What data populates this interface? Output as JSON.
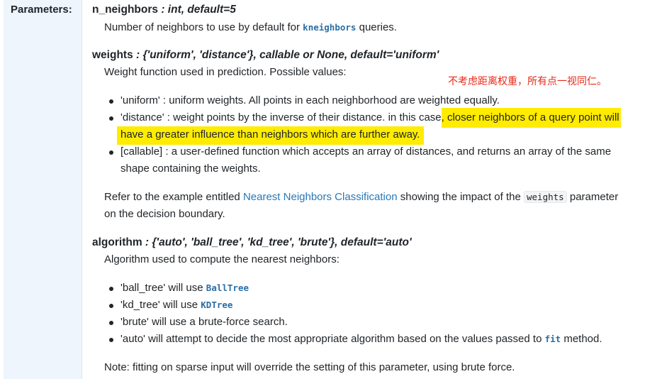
{
  "section_label": "Parameters:",
  "params": {
    "n_neighbors": {
      "name": "n_neighbors",
      "type_text": " : int, default=5",
      "desc_prefix": "Number of neighbors to use by default for ",
      "desc_code": "kneighbors",
      "desc_suffix": " queries."
    },
    "weights": {
      "name": "weights",
      "type_text": " : {'uniform', 'distance'}, callable or None, default='uniform'",
      "desc": "Weight function used in prediction. Possible values:",
      "annotation": "不考虑距离权重，所有点一视同仁。",
      "items": {
        "uniform": "'uniform' : uniform weights. All points in each neighborhood are weighted equally.",
        "distance_a": "'distance' : weight points by the inverse of their distance. in this case",
        "distance_b": ", closer neighbors of a query point will",
        "distance_c": "have a greater influence than neighbors which are further away.",
        "callable_a": "[callable] : a user-defined function which accepts an array of distances, and returns an array of the same",
        "callable_b": "shape containing the weights."
      },
      "refer_prefix": "Refer to the example entitled ",
      "refer_link": "Nearest Neighbors Classification",
      "refer_middle": " showing the impact of the ",
      "refer_code": "weights",
      "refer_suffix": " parameter",
      "refer_line2": "on the decision boundary."
    },
    "algorithm": {
      "name": "algorithm",
      "type_text": " : {'auto', 'ball_tree', 'kd_tree', 'brute'}, default='auto'",
      "desc": "Algorithm used to compute the nearest neighbors:",
      "items": {
        "ball_tree_prefix": "'ball_tree' will use ",
        "ball_tree_code": "BallTree",
        "kd_tree_prefix": "'kd_tree' will use ",
        "kd_tree_code": "KDTree",
        "brute": "'brute' will use a brute-force search.",
        "auto_prefix": "'auto' will attempt to decide the most appropriate algorithm based on the values passed to ",
        "auto_code": "fit",
        "auto_suffix": " method."
      },
      "note": "Note: fitting on sparse input will override the setting of this parameter, using brute force."
    }
  },
  "colors": {
    "highlight": "#ffec00",
    "annotation": "#e8281a",
    "link": "#2878b8",
    "code": "#2b6ea6"
  }
}
